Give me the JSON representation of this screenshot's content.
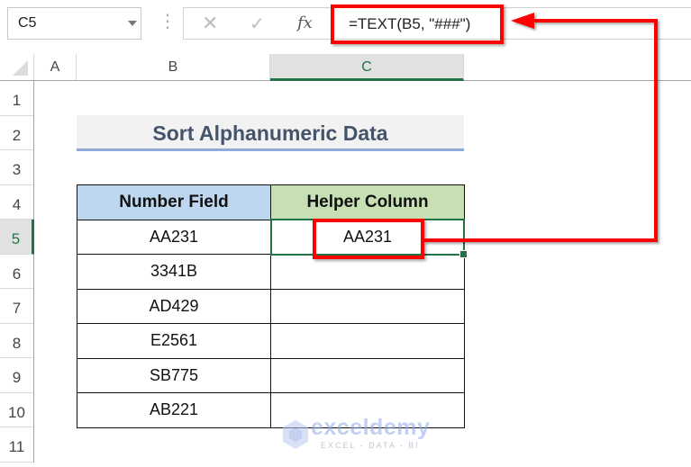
{
  "name_box": {
    "value": "C5"
  },
  "formula_bar": {
    "cancel_icon": "✕",
    "enter_icon": "✓",
    "fx_label": "fx",
    "formula": "=TEXT(B5, \"###\")"
  },
  "columns": [
    "A",
    "B",
    "C"
  ],
  "selected_column": "C",
  "rows": [
    "1",
    "2",
    "3",
    "4",
    "5",
    "6",
    "7",
    "8",
    "9",
    "10",
    "11"
  ],
  "selected_row": "5",
  "title": "Sort Alphanumeric Data",
  "table": {
    "headers": [
      "Number Field",
      "Helper Column"
    ],
    "rows": [
      [
        "AA231",
        "AA231"
      ],
      [
        "3341B",
        ""
      ],
      [
        "AD429",
        ""
      ],
      [
        "E2561",
        ""
      ],
      [
        "SB775",
        ""
      ],
      [
        "AB221",
        ""
      ]
    ]
  },
  "selected_cell": "C5",
  "watermark": {
    "brand": "exceldemy",
    "tagline": "EXCEL - DATA - BI"
  },
  "colors": {
    "excel_green": "#217346",
    "highlight_red": "#ff0000",
    "title_text": "#44546a",
    "title_bg": "#f2f2f2",
    "title_underline": "#8eaadb",
    "header_b_bg": "#bdd7ee",
    "header_c_bg": "#c6e0b4"
  }
}
